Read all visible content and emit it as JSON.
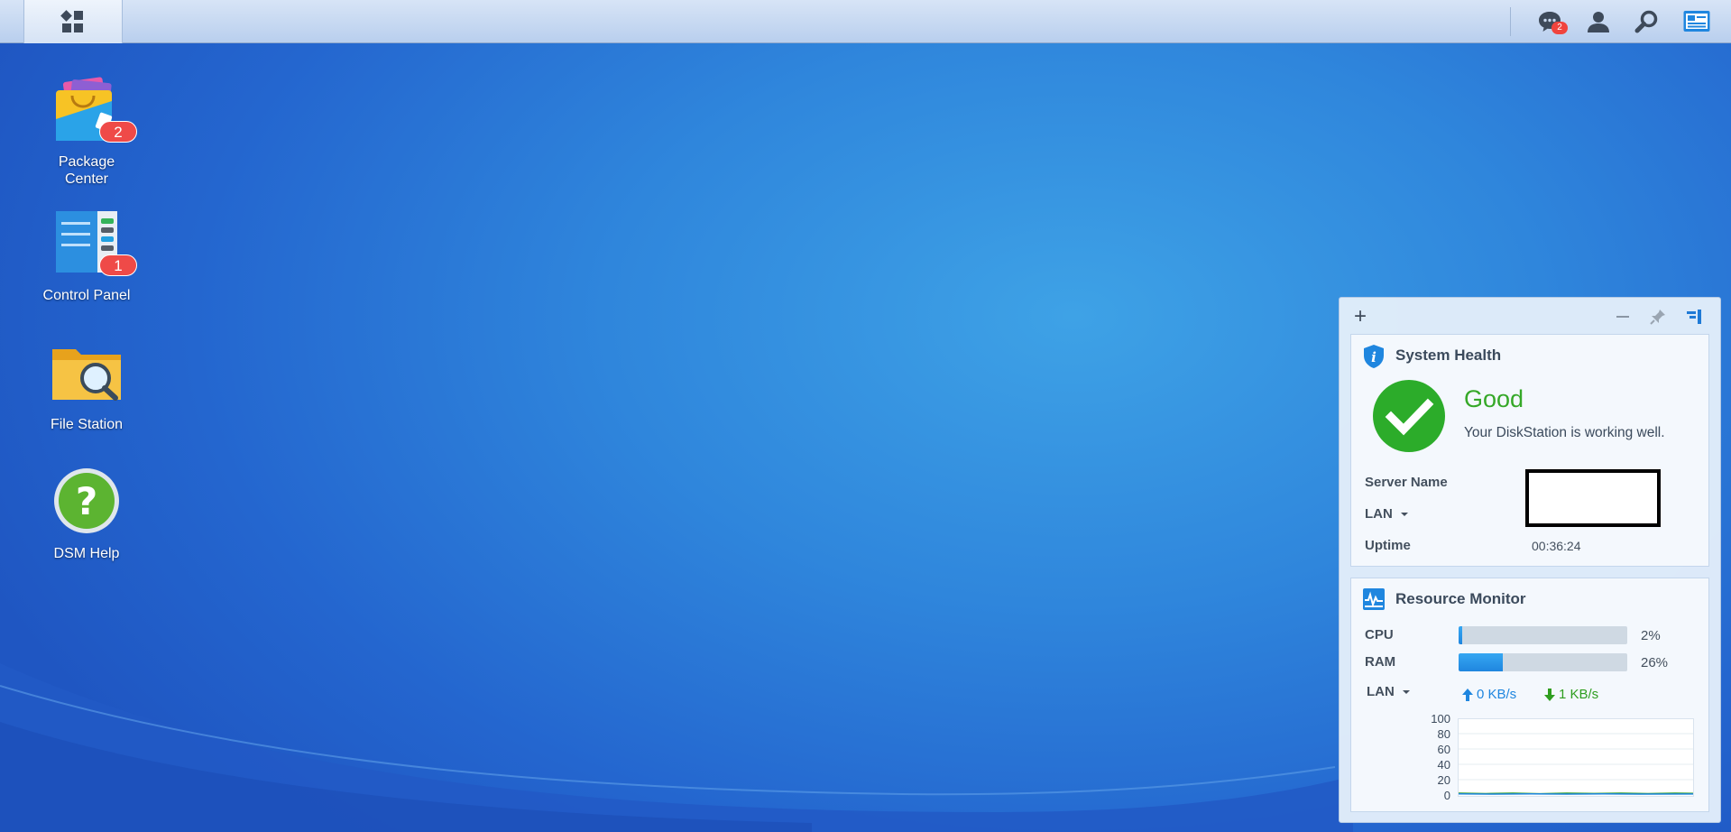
{
  "taskbar": {
    "main_menu_icon": "apps-grid-icon",
    "notifications_badge": "2",
    "icons": [
      "notifications-icon",
      "user-icon",
      "search-icon",
      "widgets-icon"
    ]
  },
  "desktop_icons": [
    {
      "label": "Package Center",
      "icon": "package-center-icon",
      "badge": "2"
    },
    {
      "label": "Control Panel",
      "icon": "control-panel-icon",
      "badge": "1"
    },
    {
      "label": "File Station",
      "icon": "file-station-icon",
      "badge": ""
    },
    {
      "label": "DSM Help",
      "icon": "help-icon",
      "badge": ""
    }
  ],
  "widgets_panel": {
    "add_label": "+",
    "system_health": {
      "title": "System Health",
      "status": "Good",
      "description": "Your DiskStation is working well.",
      "server_name_label": "Server Name",
      "server_name_value": "",
      "lan_label": "LAN",
      "uptime_label": "Uptime",
      "uptime_value": "00:36:24"
    },
    "resource_monitor": {
      "title": "Resource Monitor",
      "cpu_label": "CPU",
      "cpu_percent": 2,
      "cpu_text": "2%",
      "ram_label": "RAM",
      "ram_percent": 26,
      "ram_text": "26%",
      "lan_label": "LAN",
      "upload": "0 KB/s",
      "download": "1 KB/s",
      "chart_y_ticks": [
        "100",
        "80",
        "60",
        "40",
        "20",
        "0"
      ]
    }
  },
  "colors": {
    "good_green": "#35a828",
    "upload_blue": "#1f86df",
    "download_green": "#2f9e1f",
    "badge_red": "#ef4a48"
  }
}
